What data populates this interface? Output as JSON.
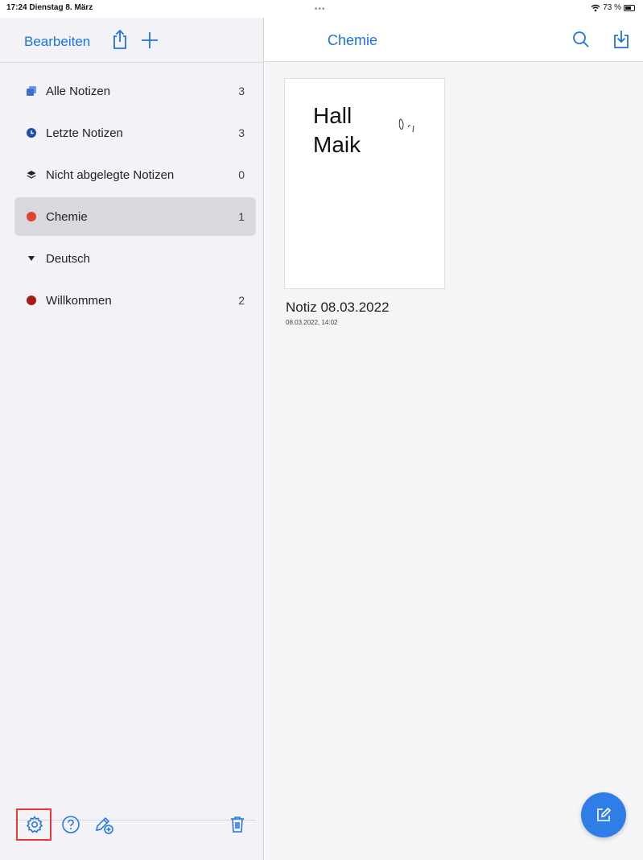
{
  "status_bar": {
    "time_date": "17:24  Dienstag 8. März",
    "dots": "•••",
    "battery_text": "73 %",
    "battery_level": 0.73
  },
  "sidebar": {
    "edit_label": "Bearbeiten",
    "folders": [
      {
        "label": "Alle Notizen",
        "count": "3",
        "icon": "notes-stack-icon",
        "color": "#3a6fd8"
      },
      {
        "label": "Letzte Notizen",
        "count": "3",
        "icon": "clock-icon",
        "color": "#1f4fa8"
      },
      {
        "label": "Nicht abgelegte Notizen",
        "count": "0",
        "icon": "layers-icon",
        "color": "#222222"
      },
      {
        "label": "Chemie",
        "count": "1",
        "icon": "dot-icon",
        "color": "#e0452b",
        "active": true
      },
      {
        "label": "Deutsch",
        "count": "",
        "icon": "triangle-down-icon",
        "color": "#222222"
      },
      {
        "label": "Willkommen",
        "count": "2",
        "icon": "dot-icon",
        "color": "#a61b1b"
      }
    ]
  },
  "main": {
    "title": "Chemie",
    "notes": [
      {
        "preview_lines": [
          "Hall",
          "Maik"
        ],
        "title": "Notiz 08.03.2022",
        "date": "08.03.2022, 14:02"
      }
    ]
  },
  "colors": {
    "accent": "#1a73e8",
    "fab": "#2f7ee8",
    "highlight": "#e53935"
  }
}
